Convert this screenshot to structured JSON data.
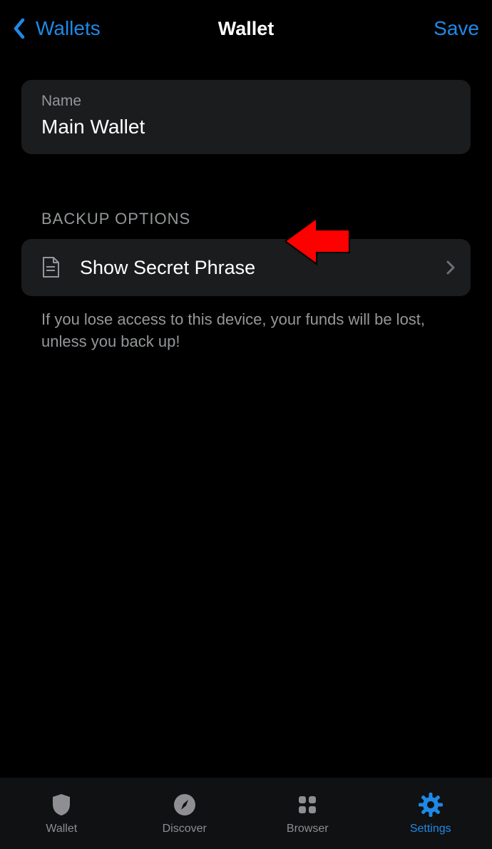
{
  "header": {
    "back_label": "Wallets",
    "title": "Wallet",
    "save_label": "Save"
  },
  "name_card": {
    "label": "Name",
    "value": "Main Wallet"
  },
  "sections": {
    "backup_header": "BACKUP OPTIONS",
    "show_secret_label": "Show Secret Phrase",
    "warning": "If you lose access to this device, your funds will be lost, unless you back up!"
  },
  "tabbar": {
    "items": [
      {
        "label": "Wallet"
      },
      {
        "label": "Discover"
      },
      {
        "label": "Browser"
      },
      {
        "label": "Settings"
      }
    ]
  },
  "colors": {
    "accent": "#1f89e6",
    "card": "#1b1c1e",
    "muted": "#94979a",
    "tabbar_bg": "#101112"
  }
}
